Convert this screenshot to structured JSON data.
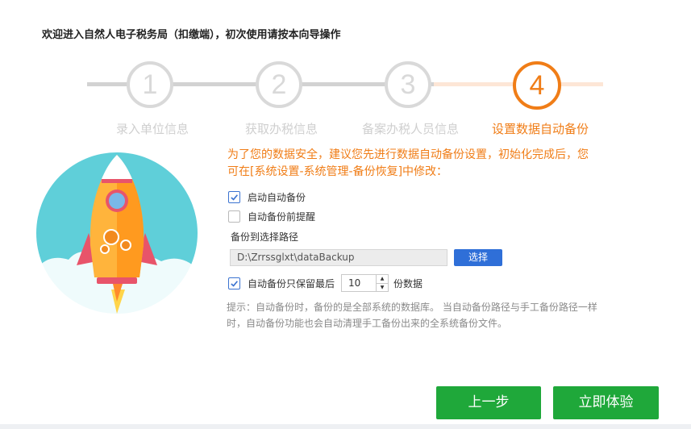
{
  "title": "欢迎进入自然人电子税务局（扣缴端），初次使用请按本向导操作",
  "steps": [
    {
      "number": "1",
      "label": "录入单位信息"
    },
    {
      "number": "2",
      "label": "获取办税信息"
    },
    {
      "number": "3",
      "label": "备案办税人员信息"
    },
    {
      "number": "4",
      "label": "设置数据自动备份"
    }
  ],
  "active_step": 4,
  "intro": "为了您的数据安全，建议您先进行数据自动备份设置，初始化完成后，您可在[系统设置-系统管理-备份恢复]中修改：",
  "options": {
    "auto_backup": {
      "label": "启动自动备份",
      "checked": true
    },
    "backup_reminder": {
      "label": "自动备份前提醒",
      "checked": false
    }
  },
  "path": {
    "label": "备份到选择路径",
    "value": "D:\\Zrrssglxt\\dataBackup",
    "choose_label": "选择"
  },
  "retain": {
    "prefix": "自动备份只保留最后",
    "value": "10",
    "suffix": "份数据",
    "checked": true
  },
  "tip": "提示：自动备份时，备份的是全部系统的数据库。 当自动备份路径与手工备份路径一样时，自动备份功能也会自动清理手工备份出来的全系统备份文件。",
  "buttons": {
    "prev": "上一步",
    "start": "立即体验"
  },
  "colors": {
    "accent": "#f07d17",
    "primary_button": "#1fa83a",
    "link_button": "#2f6fd8",
    "checkbox": "#3b73d1"
  }
}
